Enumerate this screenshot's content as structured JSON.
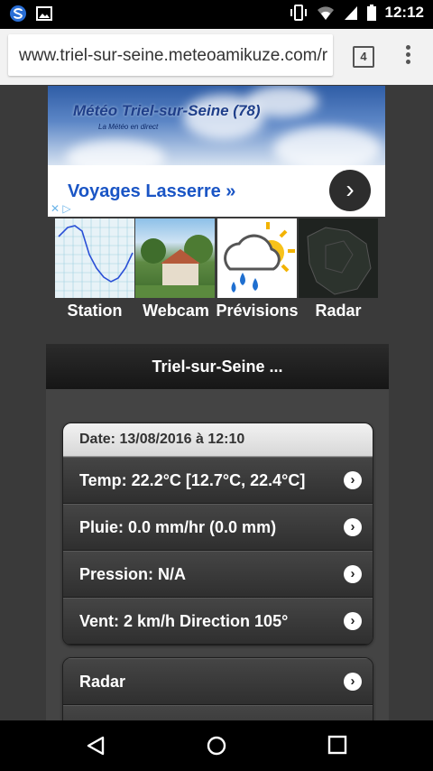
{
  "status_bar": {
    "time": "12:12",
    "icons_left": [
      "s-app-icon",
      "image-icon"
    ],
    "icons_right": [
      "vibrate-icon",
      "wifi-icon",
      "signal-icon",
      "battery-icon"
    ]
  },
  "browser": {
    "url": "www.triel-sur-seine.meteoamikuze.com/r",
    "tab_count": "4"
  },
  "banner": {
    "title": "Météo Triel-sur-Seine (78)",
    "subtitle": "La Météo en direct"
  },
  "ad": {
    "text": "Voyages Lasserre »",
    "close_label": "✕ ▷"
  },
  "quick_links": [
    {
      "label": "Station"
    },
    {
      "label": "Webcam"
    },
    {
      "label": "Prévisions"
    },
    {
      "label": "Radar"
    }
  ],
  "section_title": "Triel-sur-Seine ...",
  "weather": {
    "date": "Date: 13/08/2016 à 12:10",
    "items": [
      {
        "label": "Temp: 22.2°C [12.7°C, 22.4°C]"
      },
      {
        "label": "Pluie: 0.0 mm/hr (0.0 mm)"
      },
      {
        "label": "Pression: N/A"
      },
      {
        "label": "Vent: 2 km/h Direction 105°"
      }
    ]
  },
  "links": [
    {
      "label": "Radar"
    }
  ],
  "colors": {
    "background": "#3a3a3a",
    "ad_text": "#1a55c5",
    "header_bg": "#1e1e1e"
  }
}
